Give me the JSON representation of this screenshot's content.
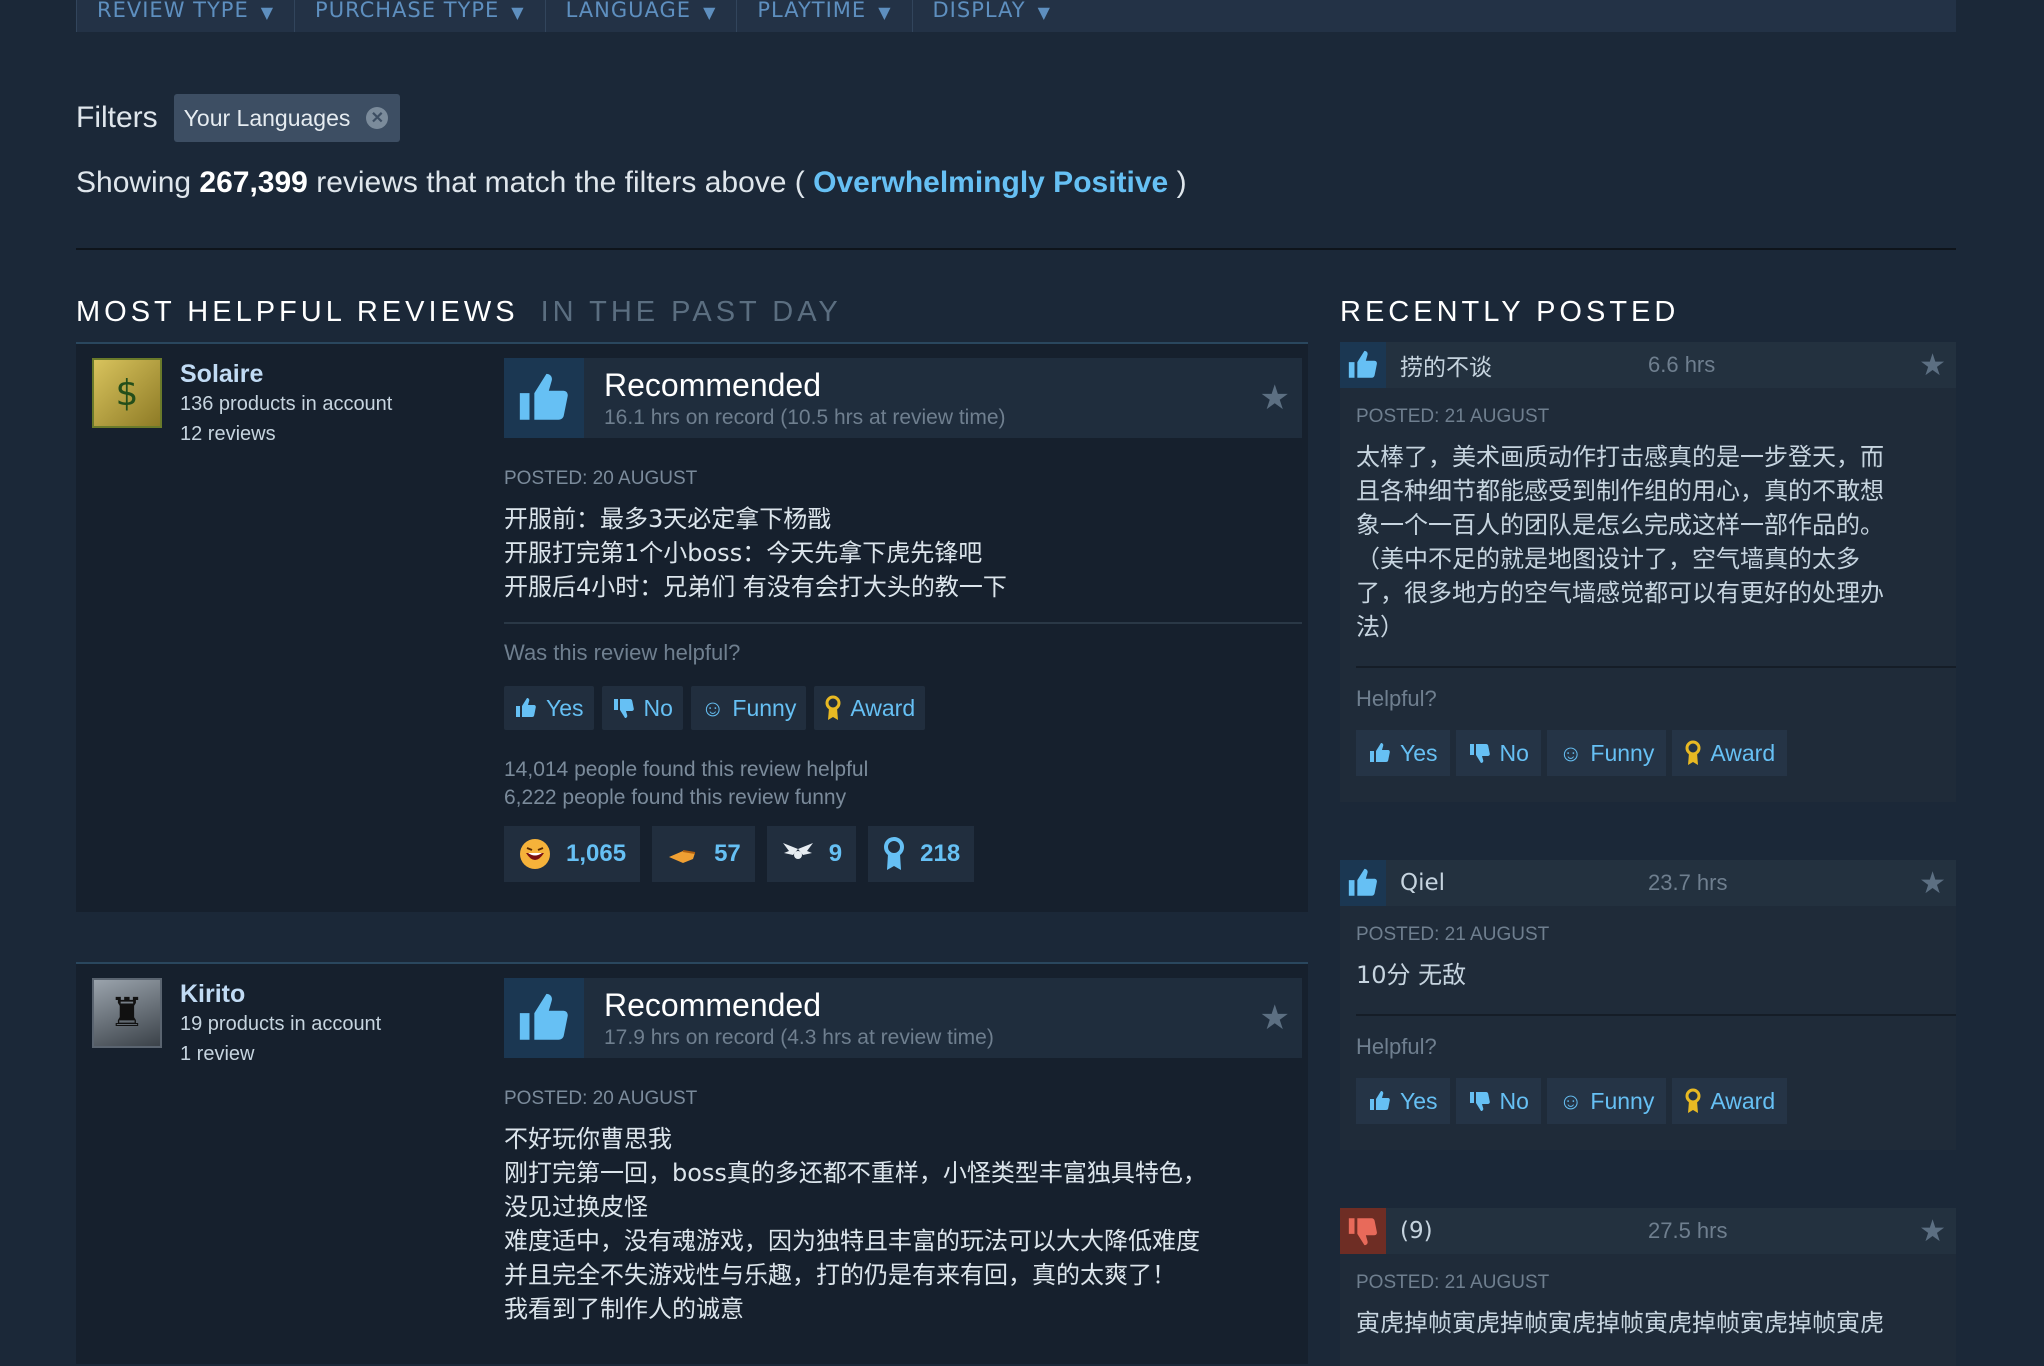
{
  "filter_bar": {
    "items": [
      "REVIEW TYPE",
      "PURCHASE TYPE",
      "LANGUAGE",
      "PLAYTIME",
      "DISPLAY"
    ]
  },
  "filters": {
    "label": "Filters",
    "chip_label": "Your Languages"
  },
  "summary": {
    "prefix": "Showing",
    "count": "267,399",
    "middle": "reviews that match the filters above (",
    "rating": "Overwhelmingly Positive",
    "suffix": ")"
  },
  "sections": {
    "helpful_title": "MOST HELPFUL REVIEWS",
    "helpful_sub": "IN THE PAST DAY",
    "recent_title": "RECENTLY POSTED"
  },
  "reviews": [
    {
      "author": "Solaire",
      "products": "136 products in account",
      "review_count": "12 reviews",
      "verdict": "Recommended",
      "hours": "16.1 hrs on record (10.5 hrs at review time)",
      "posted": "POSTED: 20 AUGUST",
      "text": "开服前：最多3天必定拿下杨戬\n开服打完第1个小boss：今天先拿下虎先锋吧\n开服后4小时：兄弟们 有没有会打大头的教一下",
      "helpful_question": "Was this review helpful?",
      "buttons": {
        "yes": "Yes",
        "no": "No",
        "funny": "Funny",
        "award": "Award"
      },
      "helpful_count": "14,014 people found this review helpful",
      "funny_count": "6,222 people found this review funny",
      "awards": [
        {
          "icon": "laughing-face-icon",
          "count": "1,065"
        },
        {
          "icon": "pointing-hand-icon",
          "count": "57"
        },
        {
          "icon": "winged-award-icon",
          "count": "9"
        },
        {
          "icon": "medal-icon",
          "count": "218"
        }
      ]
    },
    {
      "author": "Kirito",
      "products": "19 products in account",
      "review_count": "1 review",
      "verdict": "Recommended",
      "hours": "17.9 hrs on record (4.3 hrs at review time)",
      "posted": "POSTED: 20 AUGUST",
      "text": "不好玩你曹思我\n刚打完第一回，boss真的多还都不重样，小怪类型丰富独具特色，\n没见过换皮怪\n难度适中，没有魂游戏，因为独特且丰富的玩法可以大大降低难度\n并且完全不失游戏性与乐趣，打的仍是有来有回，真的太爽了！\n我看到了制作人的诚意"
    }
  ],
  "recent": [
    {
      "vote": "positive",
      "name": "捞的不谈",
      "hours": "6.6 hrs",
      "posted": "POSTED: 21 AUGUST",
      "text": "太棒了，美术画质动作打击感真的是一步登天，而\n且各种细节都能感受到制作组的用心，真的不敢想\n象一个一百人的团队是怎么完成这样一部作品的。\n（美中不足的就是地图设计了，空气墙真的太多\n了，很多地方的空气墙感觉都可以有更好的处理办\n法）",
      "helpful": "Helpful?",
      "buttons": {
        "yes": "Yes",
        "no": "No",
        "funny": "Funny",
        "award": "Award"
      }
    },
    {
      "vote": "positive",
      "name": "Qiel",
      "hours": "23.7 hrs",
      "posted": "POSTED: 21 AUGUST",
      "text": "10分 无敌",
      "helpful": "Helpful?",
      "buttons": {
        "yes": "Yes",
        "no": "No",
        "funny": "Funny",
        "award": "Award"
      }
    },
    {
      "vote": "negative",
      "name": "(9)",
      "hours": "27.5 hrs",
      "posted": "POSTED: 21 AUGUST",
      "text": "寅虎掉帧寅虎掉帧寅虎掉帧寅虎掉帧寅虎掉帧寅虎"
    }
  ],
  "colors": {
    "background": "#1b2838",
    "accent": "#66c0f4",
    "positive_thumb": "#1b3752",
    "negative_thumb": "#6e2d24"
  }
}
